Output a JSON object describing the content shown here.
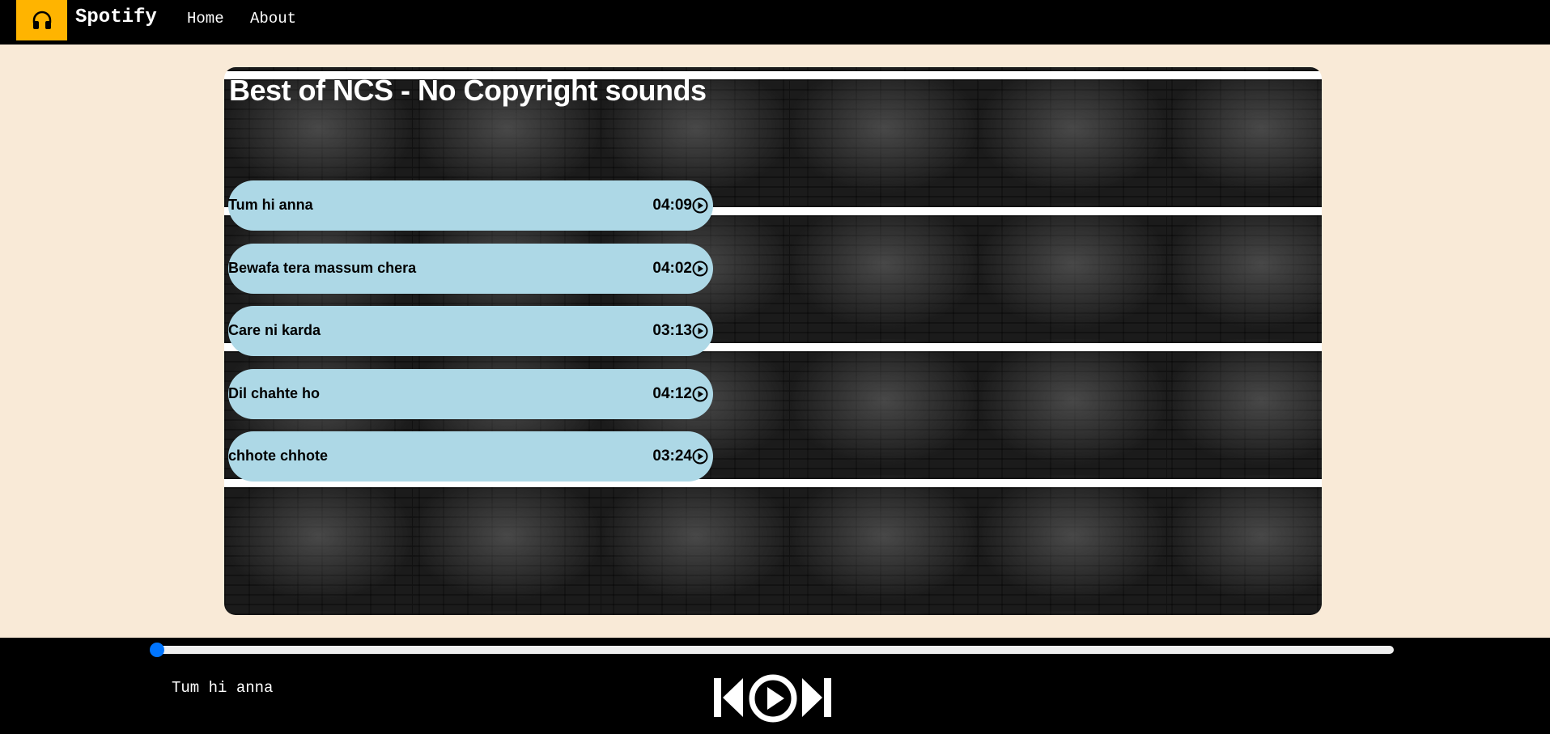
{
  "navbar": {
    "logo_icon": "headphones-icon",
    "brand": "Spotify",
    "links": [
      "Home",
      "About"
    ]
  },
  "playlist": {
    "title": "Best of NCS - No Copyright sounds",
    "songs": [
      {
        "name": "Tum hi anna",
        "duration": "04:09"
      },
      {
        "name": "Bewafa tera massum chera",
        "duration": "04:02"
      },
      {
        "name": "Care ni karda",
        "duration": "03:13"
      },
      {
        "name": "Dil chahte ho",
        "duration": "04:12"
      },
      {
        "name": "chhote chhote",
        "duration": "03:24"
      }
    ]
  },
  "player": {
    "progress": 0,
    "now_playing": "Tum hi anna",
    "controls": [
      "previous-icon",
      "play-icon",
      "next-icon"
    ]
  },
  "colors": {
    "logo_bg": "#ffb400",
    "song_bg": "#add8e6",
    "page_bg": "#f9ead7",
    "accent": "#0075ff"
  }
}
